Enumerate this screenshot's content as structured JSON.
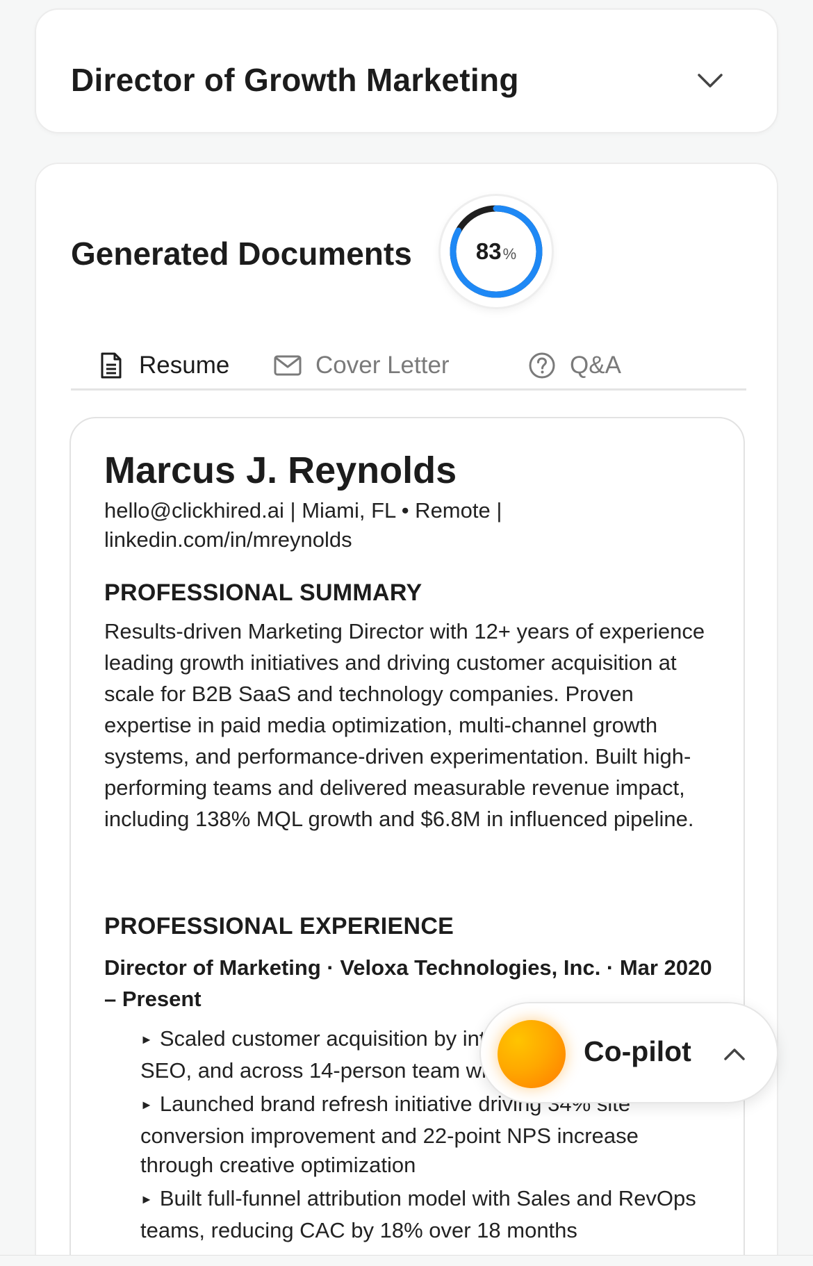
{
  "job": {
    "title": "Director of Growth Marketing"
  },
  "documents": {
    "title": "Generated Documents",
    "score": {
      "value": "83",
      "unit": "%",
      "fraction": 0.83
    },
    "tabs": [
      {
        "label": "Resume",
        "icon": "document-icon",
        "active": true
      },
      {
        "label": "Cover Letter",
        "icon": "envelope-icon",
        "active": false
      },
      {
        "label": "Q&A",
        "icon": "question-circle-icon",
        "active": false
      }
    ]
  },
  "resume": {
    "name": "Marcus J. Reynolds",
    "contact_line1": "hello@clickhired.ai | Miami, FL • Remote |",
    "contact_line2": "linkedin.com/in/mreynolds",
    "summary_heading": "PROFESSIONAL SUMMARY",
    "summary": "Results-driven Marketing Director with 12+ years of experience leading growth initiatives and driving customer acquisition at scale for B2B SaaS and technology companies. Proven expertise in paid media optimization, multi-channel growth systems, and performance-driven experimentation. Built high-performing teams and delivered measurable revenue impact, including 138% MQL growth and $6.8M in influenced pipeline.",
    "experience_heading": "PROFESSIONAL EXPERIENCE",
    "role": "Director of Marketing · Veloxa Technologies, Inc. · Mar 2020 – Present",
    "bullets": [
      "Scaled customer acquisition by integrated paid media, SEO, and across 14-person team with $4.2M budget",
      "Launched brand refresh initiative driving 34% site conversion improvement and 22-point NPS increase through creative optimization",
      "Built full-funnel attribution model with Sales and RevOps teams, reducing CAC by 18% over 18 months"
    ],
    "bullet_marker": "►"
  },
  "copilot": {
    "label": "Co-pilot"
  },
  "colors": {
    "accent": "#1e88f5",
    "ring_track": "#1f1f1f",
    "orb": "#ffa800"
  }
}
